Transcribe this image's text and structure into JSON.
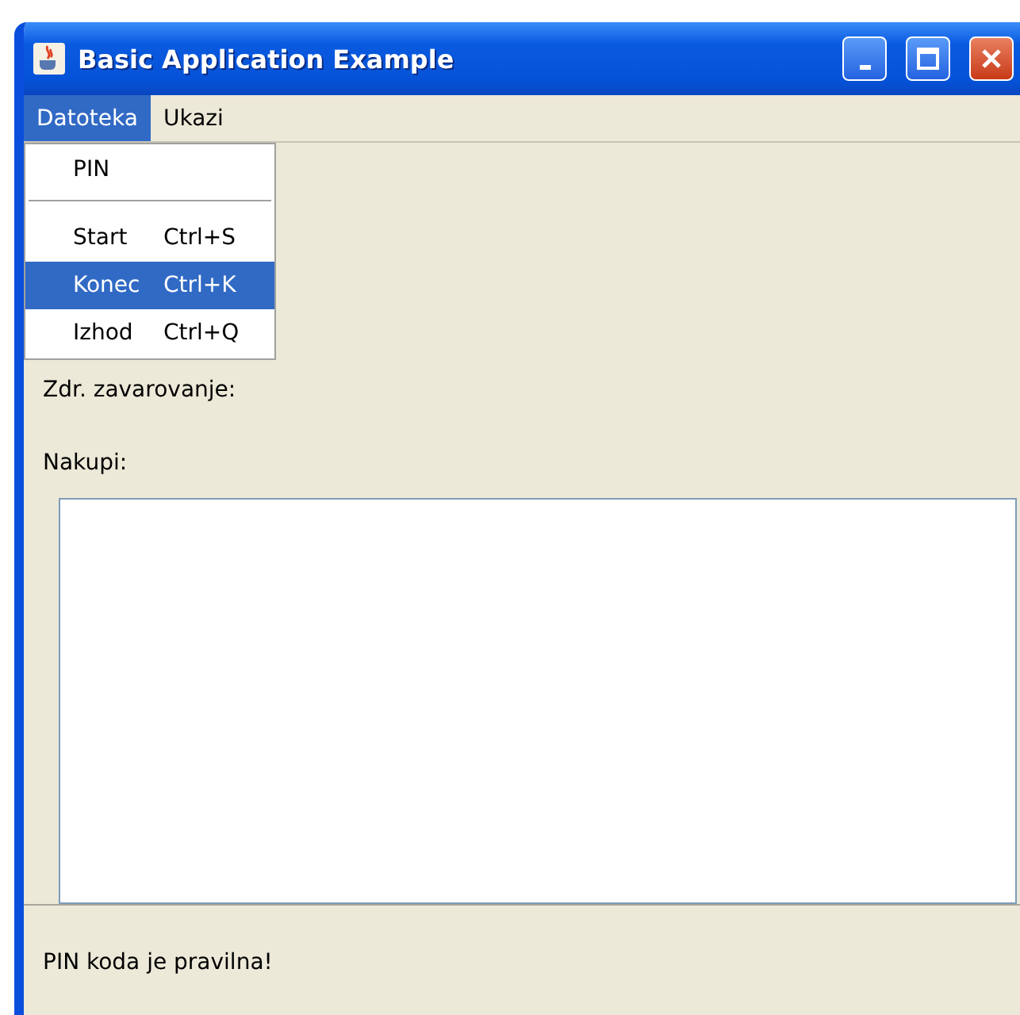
{
  "window": {
    "title": "Basic Application Example"
  },
  "menu_bar": [
    {
      "label": "Datoteka",
      "selected": true
    },
    {
      "label": "Ukazi",
      "selected": false
    }
  ],
  "menu": {
    "items": [
      {
        "kind": "item",
        "label": "PIN",
        "selected": false
      },
      {
        "kind": "separator"
      },
      {
        "kind": "item",
        "label": "Start",
        "shortcut": "Ctrl+S",
        "selected": false
      },
      {
        "kind": "item",
        "label": "Konec",
        "shortcut": "Ctrl+K",
        "selected": true
      },
      {
        "kind": "item",
        "label": "Izhod",
        "shortcut": "Ctrl+Q",
        "selected": false
      }
    ]
  },
  "labels": [
    "Zdr. zavarovanje:",
    "Nakupi:"
  ],
  "status_bar": {
    "text": "PIN koda je pravilna!"
  }
}
